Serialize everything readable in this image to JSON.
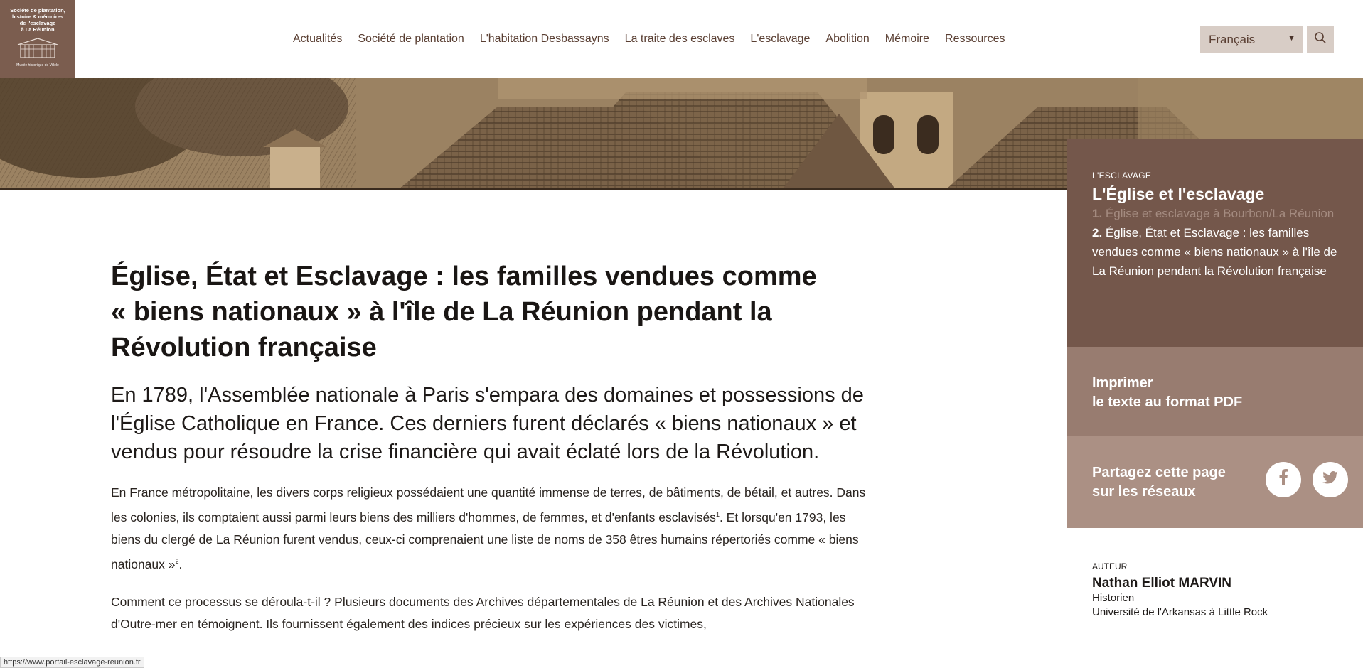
{
  "logo": {
    "line1": "Société de plantation,",
    "line2": "histoire & mémoires",
    "line3": "de l'esclavage",
    "line4": "à La Réunion",
    "sub": "Musée historique de Villèle"
  },
  "nav": {
    "items": [
      "Actualités",
      "Société de plantation",
      "L'habitation Desbassayns",
      "La traite des esclaves",
      "L'esclavage",
      "Abolition",
      "Mémoire",
      "Ressources"
    ]
  },
  "language": {
    "selected": "Français"
  },
  "toc": {
    "kicker": "L'ESCLAVAGE",
    "title": "L'Église et l'esclavage",
    "item1_num": "1.",
    "item1_text": "Église et esclavage à Bourbon/La Réunion",
    "item2_num": "2.",
    "item2_text": "Église, État et Esclavage : les familles vendues comme « biens nationaux » à l'île de La Réunion pendant la Révolution française"
  },
  "print": {
    "line1": "Imprimer",
    "line2": "le texte au format PDF"
  },
  "share": {
    "line1": "Partagez cette page",
    "line2": "sur les réseaux"
  },
  "author": {
    "kicker": "AUTEUR",
    "name": "Nathan Elliot MARVIN",
    "role": "Historien",
    "affiliation": "Université de l'Arkansas à Little Rock"
  },
  "article": {
    "title": "Église, État et Esclavage : les familles vendues comme « biens nationaux » à l'île de La Réunion pendant la Révolution française",
    "lead": "En 1789, l'Assemblée nationale à Paris s'empara des domaines et possessions de l'Église Catholique en France. Ces derniers furent déclarés « biens nationaux » et vendus pour résoudre la crise financière qui avait éclaté lors de la Révolution.",
    "p1_a": "En France métropolitaine, les divers corps religieux possédaient une quantité immense de terres, de bâtiments, de bétail, et autres. Dans les colonies, ils comptaient aussi parmi leurs biens des milliers d'hommes, de femmes, et d'enfants esclavisés",
    "p1_sup1": "1",
    "p1_b": ". Et lorsqu'en 1793, les biens du clergé de La Réunion furent vendus, ceux-ci comprenaient une liste de noms de 358 êtres humains répertoriés comme « biens nationaux »",
    "p1_sup2": "2",
    "p1_c": ".",
    "p2": "Comment ce processus se déroula-t-il ? Plusieurs documents des Archives départementales de La Réunion et des Archives Nationales d'Outre-mer en témoignent. Ils fournissent également des indices précieux sur les expériences des victimes,"
  },
  "status_url": "https://www.portail-esclavage-reunion.fr",
  "colors": {
    "brand": "#74574b",
    "print_bg": "#987c70",
    "share_bg": "#ab9084",
    "nav_text": "#5a3f33"
  }
}
